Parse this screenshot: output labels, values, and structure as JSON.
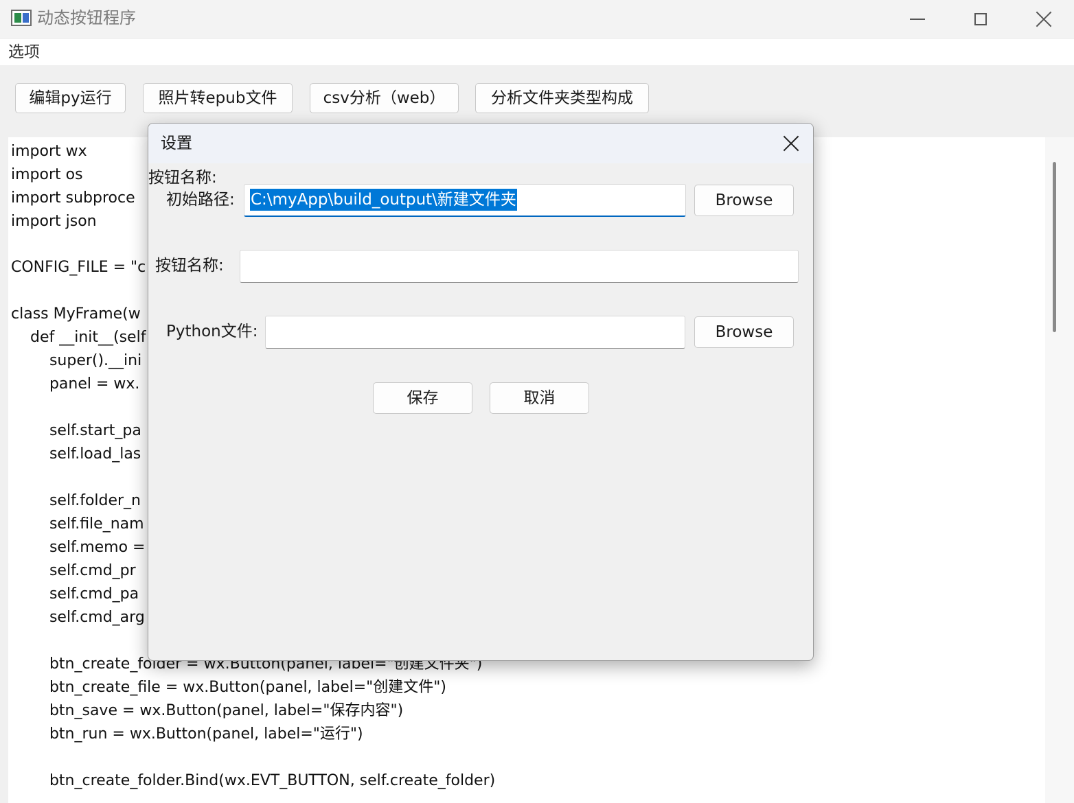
{
  "window": {
    "title": "动态按钮程序",
    "icon": "app-window-icon"
  },
  "menubar": {
    "items": [
      {
        "label": "选项"
      }
    ]
  },
  "toolbar": {
    "buttons": [
      {
        "label": "编辑py运行"
      },
      {
        "label": "照片转epub文件"
      },
      {
        "label": "csv分析（web）"
      },
      {
        "label": "分析文件夹类型构成"
      }
    ]
  },
  "editor": {
    "lines": [
      "import wx",
      "import os",
      "import subproce",
      "import json",
      "",
      "CONFIG_FILE = \"c",
      "",
      "class MyFrame(w",
      "    def __init__(self",
      "        super().__ini",
      "        panel = wx.",
      "",
      "        self.start_pa",
      "        self.load_las",
      "",
      "        self.folder_n",
      "        self.file_nam",
      "        self.memo =",
      "        self.cmd_pr",
      "        self.cmd_pa",
      "        self.cmd_arg",
      "",
      "        btn_create_folder = wx.Button(panel, label=\"创建文件夹\")",
      "        btn_create_file = wx.Button(panel, label=\"创建文件\")",
      "        btn_save = wx.Button(panel, label=\"保存内容\")",
      "        btn_run = wx.Button(panel, label=\"运行\")",
      "",
      "        btn_create_folder.Bind(wx.EVT_BUTTON, self.create_folder)"
    ]
  },
  "dialog": {
    "title": "设置",
    "top_label": "按钮名称:",
    "path_label": "初始路径:",
    "path_value": "C:\\myApp\\build_output\\新建文件夹",
    "browse_label": "Browse",
    "name_label": "按钮名称:",
    "name_value": "",
    "python_label": "Python文件:",
    "python_value": "",
    "browse2_label": "Browse",
    "save_label": "保存",
    "cancel_label": "取消"
  },
  "colors": {
    "selection": "#0078d7",
    "focus_underline": "#0067c0",
    "dialog_title_bg": "#eff2f8"
  }
}
